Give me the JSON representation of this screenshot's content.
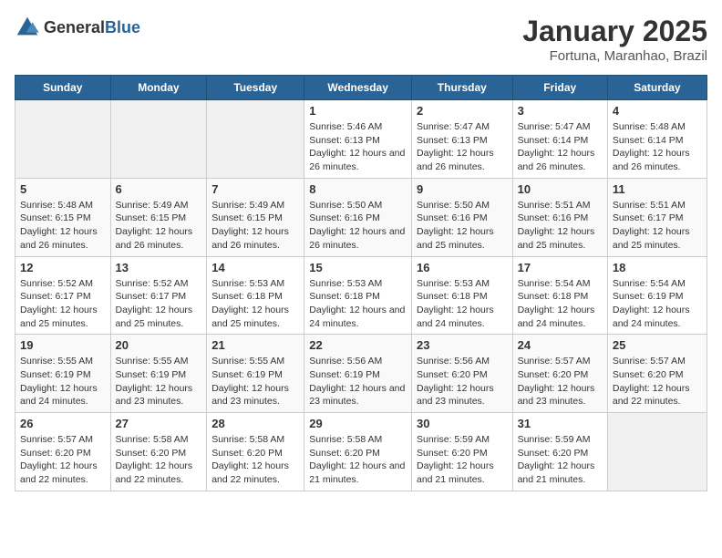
{
  "logo": {
    "text_general": "General",
    "text_blue": "Blue"
  },
  "title": "January 2025",
  "subtitle": "Fortuna, Maranhao, Brazil",
  "days_of_week": [
    "Sunday",
    "Monday",
    "Tuesday",
    "Wednesday",
    "Thursday",
    "Friday",
    "Saturday"
  ],
  "weeks": [
    [
      {
        "day": "",
        "sunrise": "",
        "sunset": "",
        "daylight": "",
        "empty": true
      },
      {
        "day": "",
        "sunrise": "",
        "sunset": "",
        "daylight": "",
        "empty": true
      },
      {
        "day": "",
        "sunrise": "",
        "sunset": "",
        "daylight": "",
        "empty": true
      },
      {
        "day": "1",
        "sunrise": "Sunrise: 5:46 AM",
        "sunset": "Sunset: 6:13 PM",
        "daylight": "Daylight: 12 hours and 26 minutes."
      },
      {
        "day": "2",
        "sunrise": "Sunrise: 5:47 AM",
        "sunset": "Sunset: 6:13 PM",
        "daylight": "Daylight: 12 hours and 26 minutes."
      },
      {
        "day": "3",
        "sunrise": "Sunrise: 5:47 AM",
        "sunset": "Sunset: 6:14 PM",
        "daylight": "Daylight: 12 hours and 26 minutes."
      },
      {
        "day": "4",
        "sunrise": "Sunrise: 5:48 AM",
        "sunset": "Sunset: 6:14 PM",
        "daylight": "Daylight: 12 hours and 26 minutes."
      }
    ],
    [
      {
        "day": "5",
        "sunrise": "Sunrise: 5:48 AM",
        "sunset": "Sunset: 6:15 PM",
        "daylight": "Daylight: 12 hours and 26 minutes."
      },
      {
        "day": "6",
        "sunrise": "Sunrise: 5:49 AM",
        "sunset": "Sunset: 6:15 PM",
        "daylight": "Daylight: 12 hours and 26 minutes."
      },
      {
        "day": "7",
        "sunrise": "Sunrise: 5:49 AM",
        "sunset": "Sunset: 6:15 PM",
        "daylight": "Daylight: 12 hours and 26 minutes."
      },
      {
        "day": "8",
        "sunrise": "Sunrise: 5:50 AM",
        "sunset": "Sunset: 6:16 PM",
        "daylight": "Daylight: 12 hours and 26 minutes."
      },
      {
        "day": "9",
        "sunrise": "Sunrise: 5:50 AM",
        "sunset": "Sunset: 6:16 PM",
        "daylight": "Daylight: 12 hours and 25 minutes."
      },
      {
        "day": "10",
        "sunrise": "Sunrise: 5:51 AM",
        "sunset": "Sunset: 6:16 PM",
        "daylight": "Daylight: 12 hours and 25 minutes."
      },
      {
        "day": "11",
        "sunrise": "Sunrise: 5:51 AM",
        "sunset": "Sunset: 6:17 PM",
        "daylight": "Daylight: 12 hours and 25 minutes."
      }
    ],
    [
      {
        "day": "12",
        "sunrise": "Sunrise: 5:52 AM",
        "sunset": "Sunset: 6:17 PM",
        "daylight": "Daylight: 12 hours and 25 minutes."
      },
      {
        "day": "13",
        "sunrise": "Sunrise: 5:52 AM",
        "sunset": "Sunset: 6:17 PM",
        "daylight": "Daylight: 12 hours and 25 minutes."
      },
      {
        "day": "14",
        "sunrise": "Sunrise: 5:53 AM",
        "sunset": "Sunset: 6:18 PM",
        "daylight": "Daylight: 12 hours and 25 minutes."
      },
      {
        "day": "15",
        "sunrise": "Sunrise: 5:53 AM",
        "sunset": "Sunset: 6:18 PM",
        "daylight": "Daylight: 12 hours and 24 minutes."
      },
      {
        "day": "16",
        "sunrise": "Sunrise: 5:53 AM",
        "sunset": "Sunset: 6:18 PM",
        "daylight": "Daylight: 12 hours and 24 minutes."
      },
      {
        "day": "17",
        "sunrise": "Sunrise: 5:54 AM",
        "sunset": "Sunset: 6:18 PM",
        "daylight": "Daylight: 12 hours and 24 minutes."
      },
      {
        "day": "18",
        "sunrise": "Sunrise: 5:54 AM",
        "sunset": "Sunset: 6:19 PM",
        "daylight": "Daylight: 12 hours and 24 minutes."
      }
    ],
    [
      {
        "day": "19",
        "sunrise": "Sunrise: 5:55 AM",
        "sunset": "Sunset: 6:19 PM",
        "daylight": "Daylight: 12 hours and 24 minutes."
      },
      {
        "day": "20",
        "sunrise": "Sunrise: 5:55 AM",
        "sunset": "Sunset: 6:19 PM",
        "daylight": "Daylight: 12 hours and 23 minutes."
      },
      {
        "day": "21",
        "sunrise": "Sunrise: 5:55 AM",
        "sunset": "Sunset: 6:19 PM",
        "daylight": "Daylight: 12 hours and 23 minutes."
      },
      {
        "day": "22",
        "sunrise": "Sunrise: 5:56 AM",
        "sunset": "Sunset: 6:19 PM",
        "daylight": "Daylight: 12 hours and 23 minutes."
      },
      {
        "day": "23",
        "sunrise": "Sunrise: 5:56 AM",
        "sunset": "Sunset: 6:20 PM",
        "daylight": "Daylight: 12 hours and 23 minutes."
      },
      {
        "day": "24",
        "sunrise": "Sunrise: 5:57 AM",
        "sunset": "Sunset: 6:20 PM",
        "daylight": "Daylight: 12 hours and 23 minutes."
      },
      {
        "day": "25",
        "sunrise": "Sunrise: 5:57 AM",
        "sunset": "Sunset: 6:20 PM",
        "daylight": "Daylight: 12 hours and 22 minutes."
      }
    ],
    [
      {
        "day": "26",
        "sunrise": "Sunrise: 5:57 AM",
        "sunset": "Sunset: 6:20 PM",
        "daylight": "Daylight: 12 hours and 22 minutes."
      },
      {
        "day": "27",
        "sunrise": "Sunrise: 5:58 AM",
        "sunset": "Sunset: 6:20 PM",
        "daylight": "Daylight: 12 hours and 22 minutes."
      },
      {
        "day": "28",
        "sunrise": "Sunrise: 5:58 AM",
        "sunset": "Sunset: 6:20 PM",
        "daylight": "Daylight: 12 hours and 22 minutes."
      },
      {
        "day": "29",
        "sunrise": "Sunrise: 5:58 AM",
        "sunset": "Sunset: 6:20 PM",
        "daylight": "Daylight: 12 hours and 21 minutes."
      },
      {
        "day": "30",
        "sunrise": "Sunrise: 5:59 AM",
        "sunset": "Sunset: 6:20 PM",
        "daylight": "Daylight: 12 hours and 21 minutes."
      },
      {
        "day": "31",
        "sunrise": "Sunrise: 5:59 AM",
        "sunset": "Sunset: 6:20 PM",
        "daylight": "Daylight: 12 hours and 21 minutes."
      },
      {
        "day": "",
        "sunrise": "",
        "sunset": "",
        "daylight": "",
        "empty": true
      }
    ]
  ]
}
